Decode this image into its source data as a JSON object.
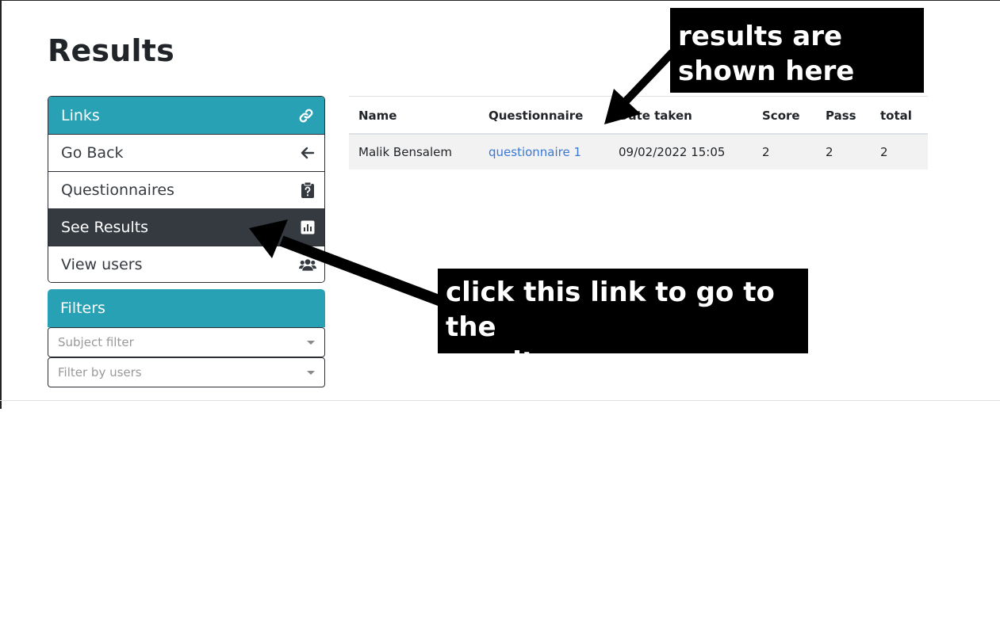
{
  "page": {
    "title": "Results"
  },
  "links_panel": {
    "header": "Links",
    "items": [
      {
        "label": "Go Back",
        "icon": "arrow-left-icon"
      },
      {
        "label": "Questionnaires",
        "icon": "clipboard-question-icon"
      },
      {
        "label": "See Results",
        "icon": "chart-icon",
        "active": true
      },
      {
        "label": "View users",
        "icon": "users-icon"
      }
    ]
  },
  "filters_panel": {
    "header": "Filters",
    "subject_placeholder": "Subject filter",
    "users_placeholder": "Filter by users"
  },
  "table": {
    "headers": [
      "Name",
      "Questionnaire",
      "Date taken",
      "Score",
      "Pass",
      "total"
    ],
    "rows": [
      {
        "name": "Malik Bensalem",
        "questionnaire": "questionnaire 1",
        "date": "09/02/2022 15:05",
        "score": "2",
        "pass": "2",
        "total": "2"
      }
    ]
  },
  "annotations": {
    "top_line1": "results are",
    "top_line2": "shown here",
    "bottom_line1": "click this link to go to the",
    "bottom_line2": "results page"
  },
  "colors": {
    "accent": "#29a1b5",
    "active_bg": "#343a40",
    "link": "#3a78d6"
  }
}
